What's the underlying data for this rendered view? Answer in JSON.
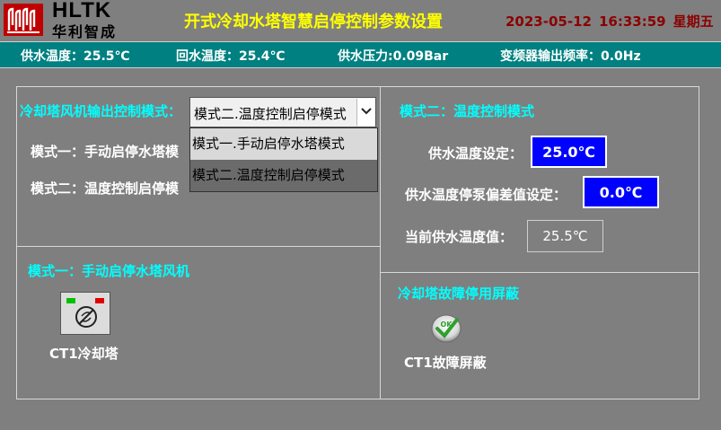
{
  "header": {
    "logo_en": "HLTK",
    "logo_cn": "华利智成",
    "title": "开式冷却水塔智慧启停控制参数设置",
    "date": "2023-05-12",
    "time": "16:33:59",
    "weekday": "星期五"
  },
  "status": {
    "supply_temp": "供水温度：25.5℃",
    "return_temp": "回水温度：25.4℃",
    "supply_pressure": "供水压力:0.09Bar",
    "vfd_freq": "变频器输出频率：0.0Hz"
  },
  "mode_panel": {
    "label": "冷却塔风机输出控制模式：",
    "selected": "模式二.温度控制启停模式",
    "options": [
      "模式一.手动启停水塔模式",
      "模式二.温度控制启停模式"
    ],
    "mode1_desc": "模式一：手动启停水塔模",
    "mode2_desc": "模式二：温度控制启停模"
  },
  "manual_panel": {
    "title": "模式一：手动启停水塔风机",
    "fan_label": "CT1冷却塔"
  },
  "temp_panel": {
    "title": "模式二：温度控制模式",
    "setpoint_label": "供水温度设定：",
    "setpoint_value": "25.0℃",
    "deviation_label": "供水温度停泵偏差值设定：",
    "deviation_value": "0.0℃",
    "current_label": "当前供水温度值：",
    "current_value": "25.5℃"
  },
  "fault_panel": {
    "title": "冷却塔故障停用屏蔽",
    "ok_text": "OK",
    "button_label": "CT1故障屏蔽"
  },
  "colors": {
    "background": "#7f7f7f",
    "status_bar": "#008080",
    "title": "#ffff00",
    "datetime": "#8b0000",
    "section_title": "#00ffff",
    "setpoint_box": "#0000ff"
  }
}
